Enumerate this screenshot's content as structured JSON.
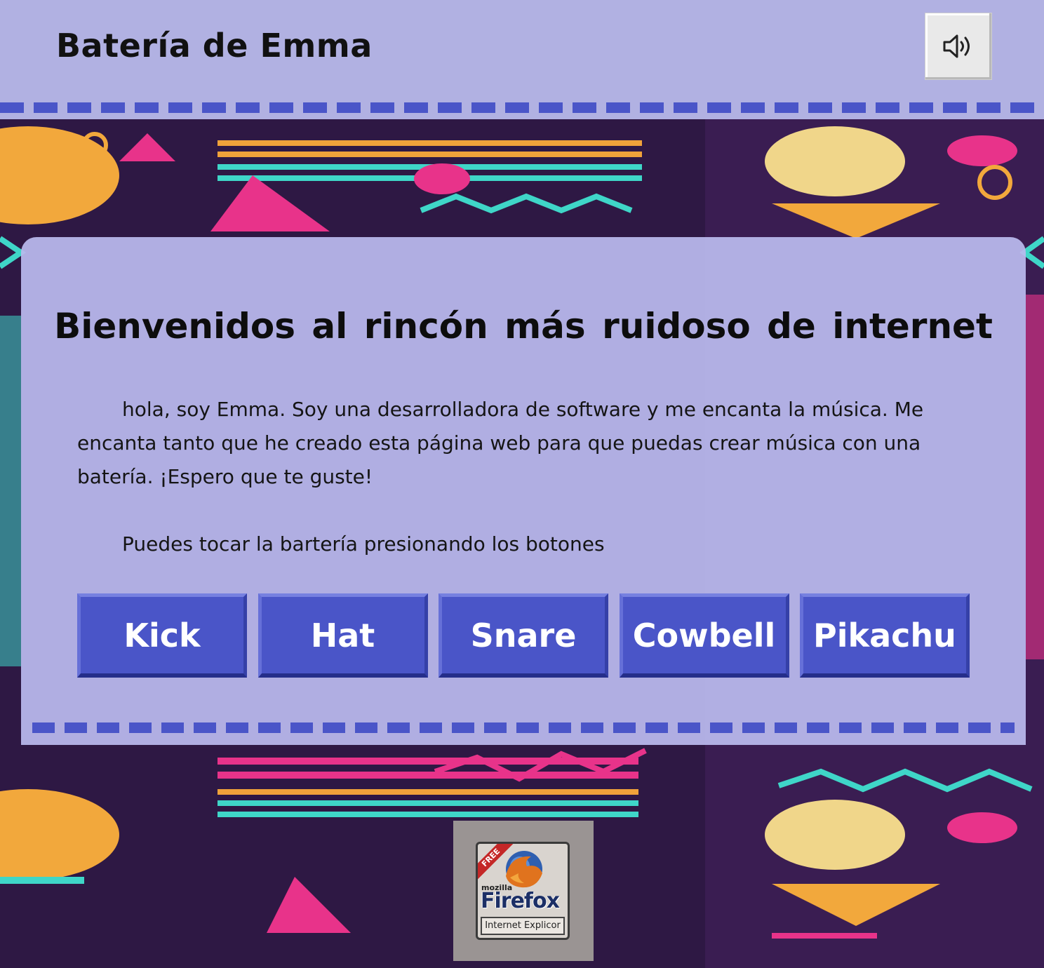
{
  "header": {
    "title": "Batería de Emma",
    "sound_icon": "speaker-volume-icon"
  },
  "main": {
    "heading": "Bienvenidos al rincón más ruidoso de internet",
    "intro": "hola, soy Emma. Soy una desarrolladora de software y me encanta la música. Me encanta tanto que he creado esta página web para que puedas crear música con una batería. ¡Espero que te guste!",
    "instructions": "Puedes tocar la bartería presionando los botones",
    "pads": [
      "Kick",
      "Hat",
      "Snare",
      "Cowbell",
      "Pikachu"
    ]
  },
  "footer": {
    "badge": {
      "corner": "FREE",
      "brand_small": "mozilla",
      "brand": "Firefox",
      "subtitle": "Internet Explicor"
    }
  },
  "colors": {
    "header_bg": "#b1b1e2",
    "accent": "#4a55c8",
    "card_bg": "#babaee"
  }
}
